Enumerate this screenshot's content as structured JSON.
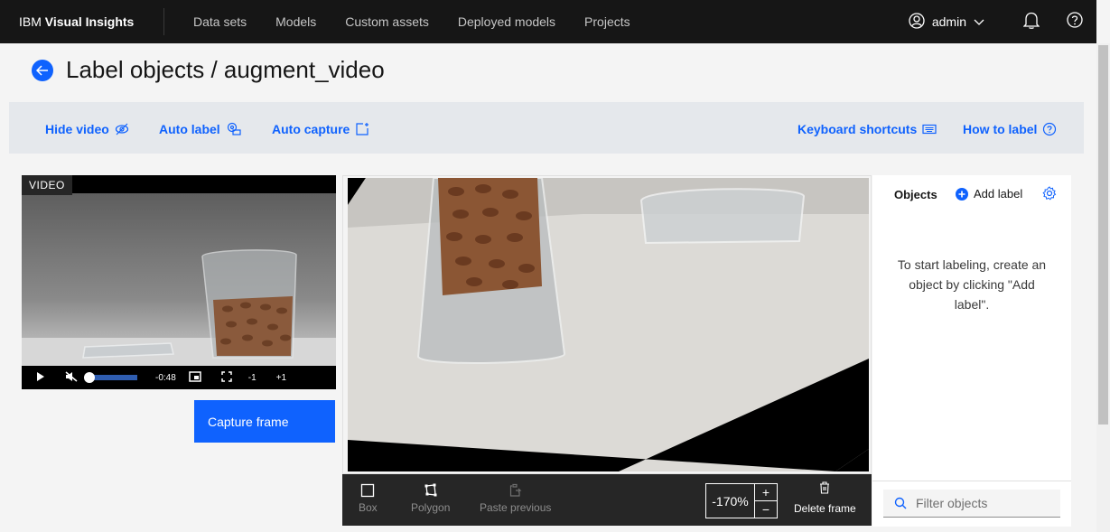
{
  "nav": {
    "brand_prefix": "IBM",
    "brand_name": "Visual Insights",
    "items": [
      "Data sets",
      "Models",
      "Custom assets",
      "Deployed models",
      "Projects"
    ],
    "user": "admin"
  },
  "page": {
    "title": "Label objects / augment_video"
  },
  "toolbar": {
    "hide_video": "Hide video",
    "auto_label": "Auto label",
    "auto_capture": "Auto capture",
    "keyboard_shortcuts": "Keyboard shortcuts",
    "how_to_label": "How to label"
  },
  "video": {
    "tag": "VIDEO",
    "time": "-0:48",
    "step_back": "-1",
    "step_forward": "+1",
    "progress": 0.05,
    "capture_label": "Capture frame"
  },
  "tools": {
    "box": "Box",
    "polygon": "Polygon",
    "paste_previous": "Paste previous",
    "zoom": "-170%",
    "zoom_in": "+",
    "zoom_out": "−",
    "delete_frame": "Delete frame"
  },
  "objects": {
    "heading": "Objects",
    "add_label": "Add label",
    "empty_message": "To start labeling, create an object by clicking \"Add label\".",
    "filter_placeholder": "Filter objects"
  },
  "colors": {
    "accent": "#0f62fe",
    "nav_bg": "#161616"
  }
}
